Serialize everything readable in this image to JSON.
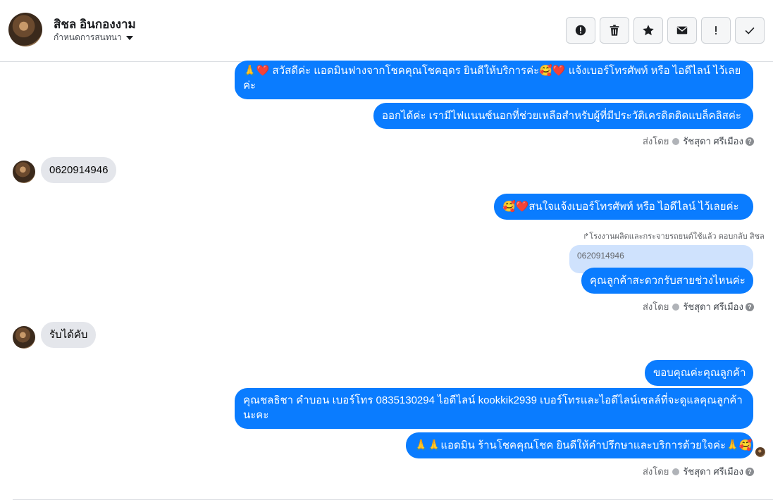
{
  "header": {
    "contact_name": "สิชล อินกองงาม",
    "subtitle": "กำหนดการสนทนา",
    "actions": [
      {
        "icon": "alert-circle-icon"
      },
      {
        "icon": "trash-icon"
      },
      {
        "icon": "star-icon"
      },
      {
        "icon": "envelope-icon"
      },
      {
        "icon": "exclamation-icon"
      },
      {
        "icon": "checkmark-icon"
      }
    ]
  },
  "messages": {
    "m1": "🙏❤️ สวัสดีค่ะ แอดมินฟางจากโชคคุณโชคอุดร ยินดีให้บริการค่ะ🥰❤️ แจ้งเบอร์โทรศัพท์ หรือ ไอดีไลน์  ไว้เลยค่ะ",
    "m2": "ออกได้ค่ะ เรามีไฟแนนซ์นอกที่ช่วยเหลือสำหรับผู้ที่มีประวัติเครดิตติดแบล็คลิสค่ะ",
    "sent_by_1": "ส่งโดย",
    "agent_name_1": "รัชสุดา ศรีเมือง",
    "in1": "0620914946",
    "m3": "🥰❤️สนใจแจ้งเบอร์โทรศัพท์ หรือ ไอดีไลน์  ไว้เลยค่ะ",
    "reply_note": "↱โรงงานผลิตและกระจายรถยนต์ใช้แล้ว ตอบกลับ สิชล",
    "quoted": "0620914946",
    "m4": "คุณลูกค้าสะดวกรับสายช่วงไหนค่ะ",
    "sent_by_2": "ส่งโดย",
    "agent_name_2": "รัชสุดา ศรีเมือง",
    "in2": "รับได้คับ",
    "m5": "ขอบคุณค่ะคุณลูกค้า",
    "m6": "คุณชลธิชา คำบอน เบอร์โทร 0835130294  ไอดีไลน์ kookkik2939   เบอร์โทรและไอดีไลน์เซลล์ที่จะดูแลคุณลูกค้านะคะ",
    "m7": "🙏🙏แอดมิน ร้านโชคคุณโชค ยินดีให้คำปรึกษาและบริการด้วยใจค่ะ🙏🥰",
    "sent_by_3": "ส่งโดย",
    "agent_name_3": "รัชสุดา ศรีเมือง"
  },
  "colors": {
    "outgoing_bubble": "#0a7cff",
    "incoming_bubble": "#e4e6eb",
    "quoted_bubble": "#cfe2fd"
  }
}
